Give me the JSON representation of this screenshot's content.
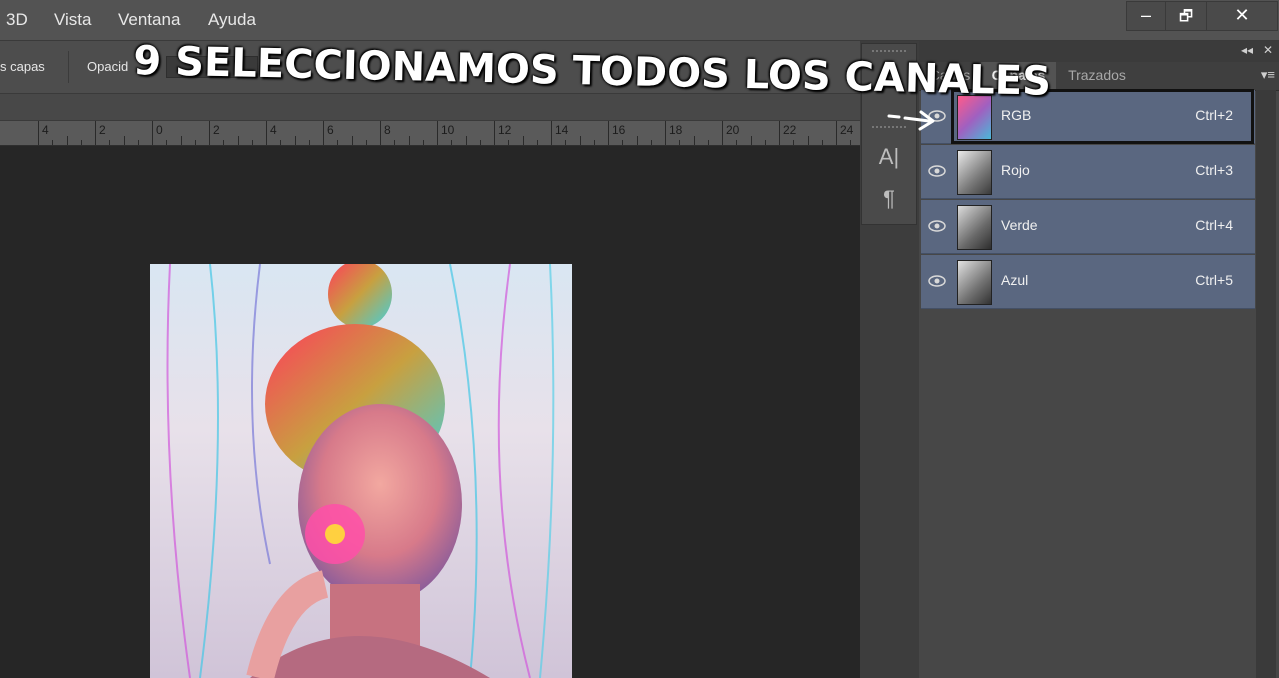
{
  "menu": {
    "items": [
      "3D",
      "Vista",
      "Ventana",
      "Ayuda"
    ]
  },
  "window_controls": {
    "minimize": "–",
    "restore": "🗗",
    "close": "✕"
  },
  "options_bar": {
    "layers_label": "s capas",
    "opacity_label": "Opacid"
  },
  "ruler": {
    "labels": [
      "4",
      "2",
      "0",
      "2",
      "4",
      "6",
      "8",
      "10",
      "12",
      "14",
      "16",
      "18",
      "20",
      "22",
      "24"
    ]
  },
  "tools": {
    "text_tool": "A|",
    "paragraph_tool": "¶"
  },
  "panel": {
    "tabs": [
      {
        "label": "Capas",
        "active": false
      },
      {
        "label": "Canales",
        "active": true
      },
      {
        "label": "Trazados",
        "active": false
      }
    ],
    "channels": [
      {
        "name": "RGB",
        "shortcut": "Ctrl+2"
      },
      {
        "name": "Rojo",
        "shortcut": "Ctrl+3"
      },
      {
        "name": "Verde",
        "shortcut": "Ctrl+4"
      },
      {
        "name": "Azul",
        "shortcut": "Ctrl+5"
      }
    ]
  },
  "annotation": {
    "caption": "9 SELECCIONAMOS TODOS LOS CANALES"
  },
  "colors": {
    "selected_row": "#5a6780",
    "accent": "#ffffff"
  }
}
